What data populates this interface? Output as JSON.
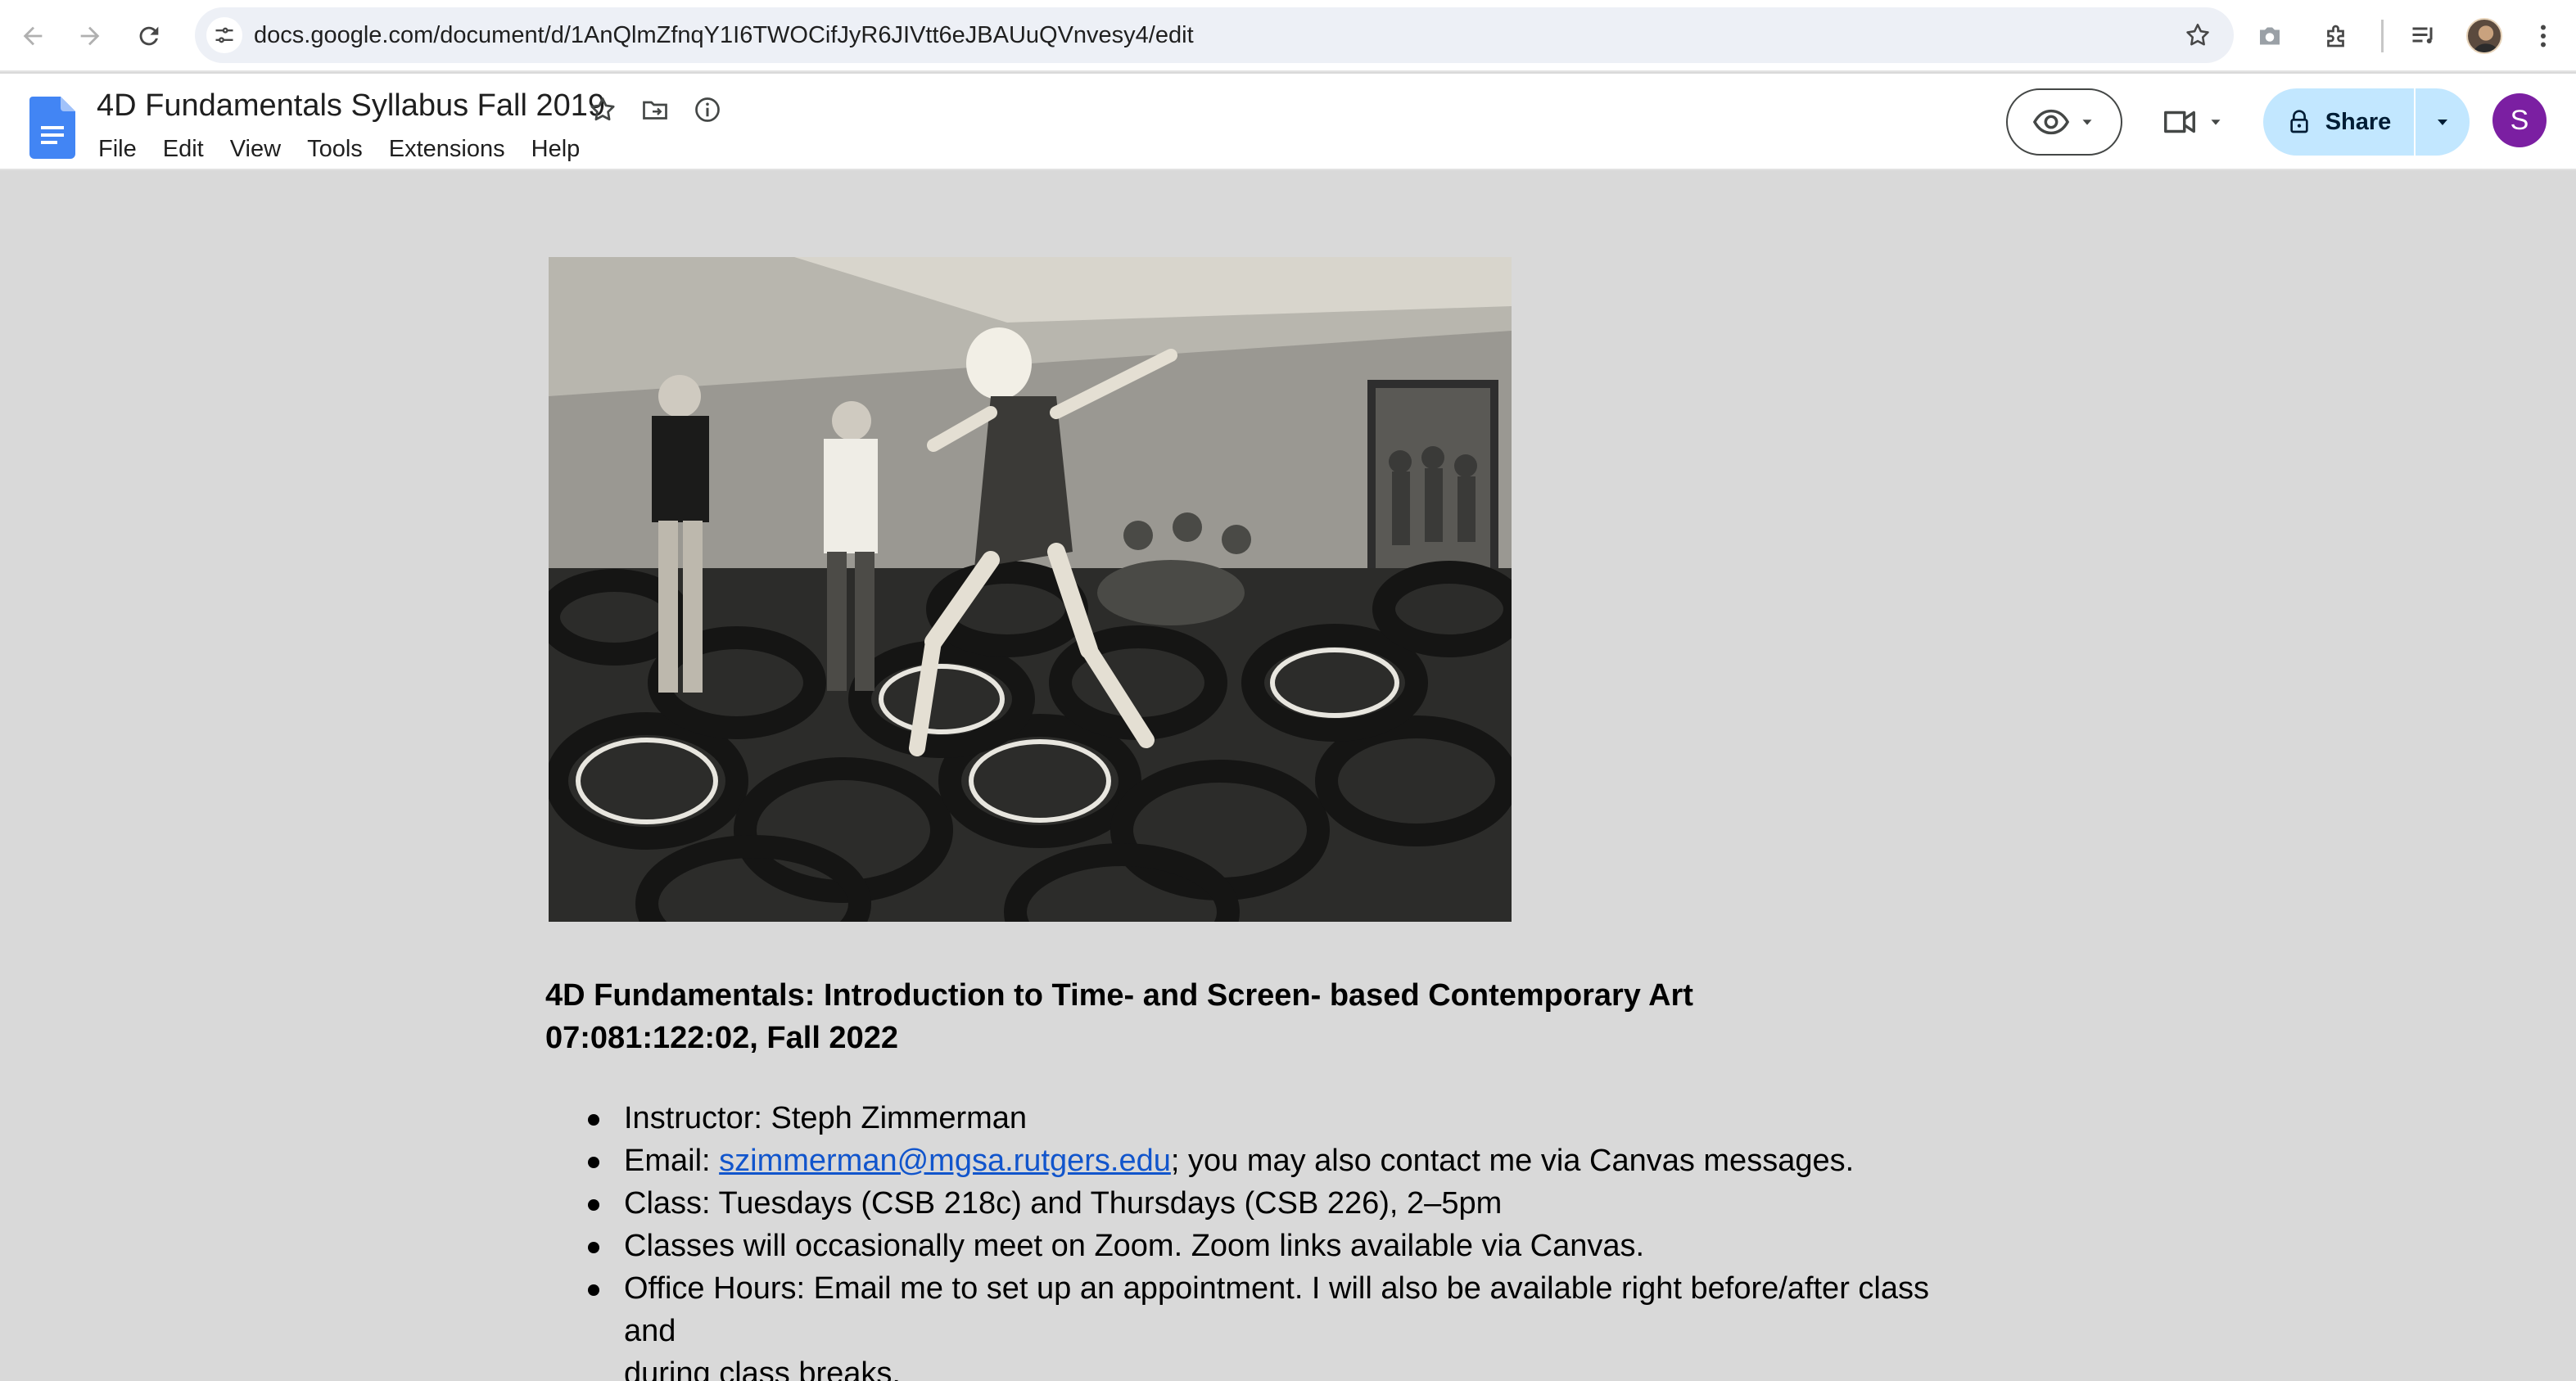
{
  "browser": {
    "url": "docs.google.com/document/d/1AnQlmZfnqY1I6TWOCifJyR6JIVtt6eJBAUuQVnvesy4/edit",
    "icons": [
      "back-arrow-icon",
      "forward-arrow-icon",
      "reload-icon",
      "site-settings-icon",
      "bookmark-star-icon",
      "screenshot-camera-icon",
      "extensions-puzzle-icon",
      "media-queue-icon",
      "profile-avatar",
      "more-vert-icon"
    ]
  },
  "docs": {
    "title": "4D Fundamentals Syllabus Fall 2019",
    "menu": [
      "File",
      "Edit",
      "View",
      "Tools",
      "Extensions",
      "Help"
    ],
    "share_label": "Share",
    "avatar_letter": "S"
  },
  "document": {
    "image_alt": "Black and white photo of people climbing over a room filled with tires",
    "heading_line1": "4D Fundamentals: Introduction to Time- and Screen- based Contemporary Art",
    "heading_line2": "07:081:122:02, Fall 2022",
    "bullets": {
      "instructor": "Instructor: Steph Zimmerman",
      "email_prefix": "Email: ",
      "email_link": "szimmerman@mgsa.rutgers.edu",
      "email_suffix": "; you may also contact me via Canvas messages.",
      "class": "Class: Tuesdays (CSB 218c) and Thursdays (CSB 226), 2–5pm",
      "zoom": "Classes will occasionally meet on Zoom. Zoom links available via Canvas.",
      "office_hours_1": "Office Hours: Email me to set up an appointment. I will also be available right before/after class and",
      "office_hours_2": "during class breaks."
    }
  },
  "colors": {
    "accent_blue": "#1a73e8",
    "share_bg": "#c2e7ff",
    "avatar_purple": "#7b1fa2",
    "link": "#1155cc",
    "canvas_bg": "#d9d9d9"
  }
}
